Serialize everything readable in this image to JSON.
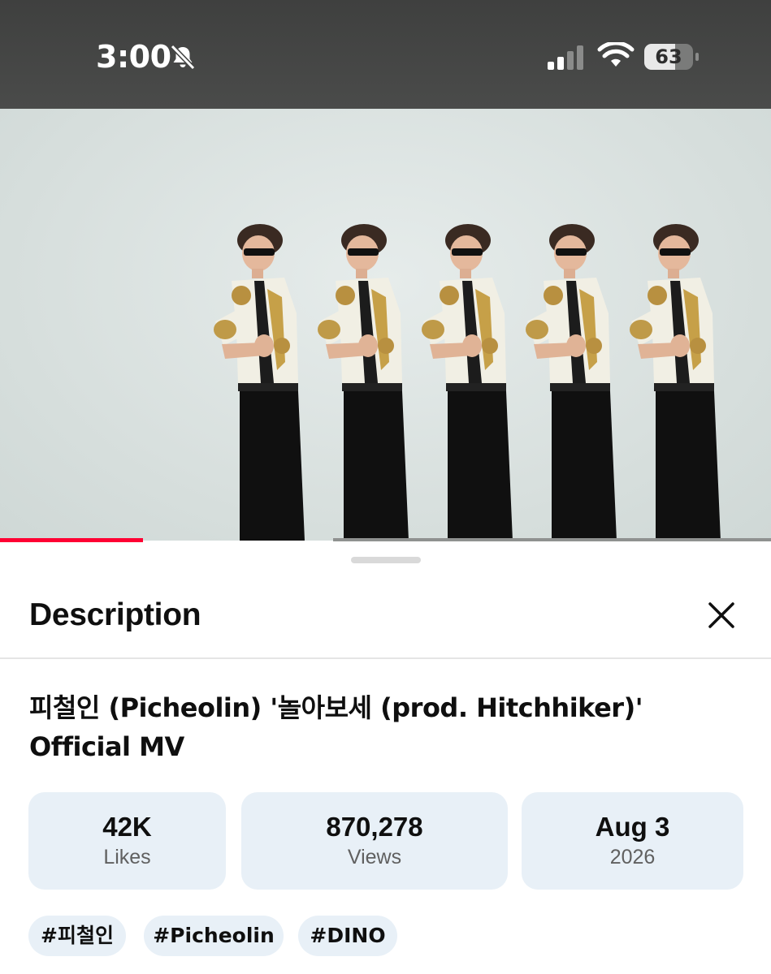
{
  "status_bar": {
    "time": "3:00",
    "silent_icon": "bell-slash-icon",
    "signal_icon": "cellular-signal-icon",
    "wifi_icon": "wifi-icon",
    "battery_level": "63"
  },
  "video": {
    "progress": 0.185,
    "accent_color": "#ff0033"
  },
  "sheet": {
    "title": "Description",
    "close_icon": "close-icon",
    "video_title": "피철인 (Picheolin) '놀아보세 (prod. Hitchhiker)' Official MV",
    "stats": [
      {
        "value": "42K",
        "label": "Likes"
      },
      {
        "value": "870,278",
        "label": "Views"
      },
      {
        "value": "Aug 3",
        "label": "2026"
      }
    ],
    "hashtags": [
      "#피철인",
      "#Picheolin",
      "#DINO"
    ]
  }
}
